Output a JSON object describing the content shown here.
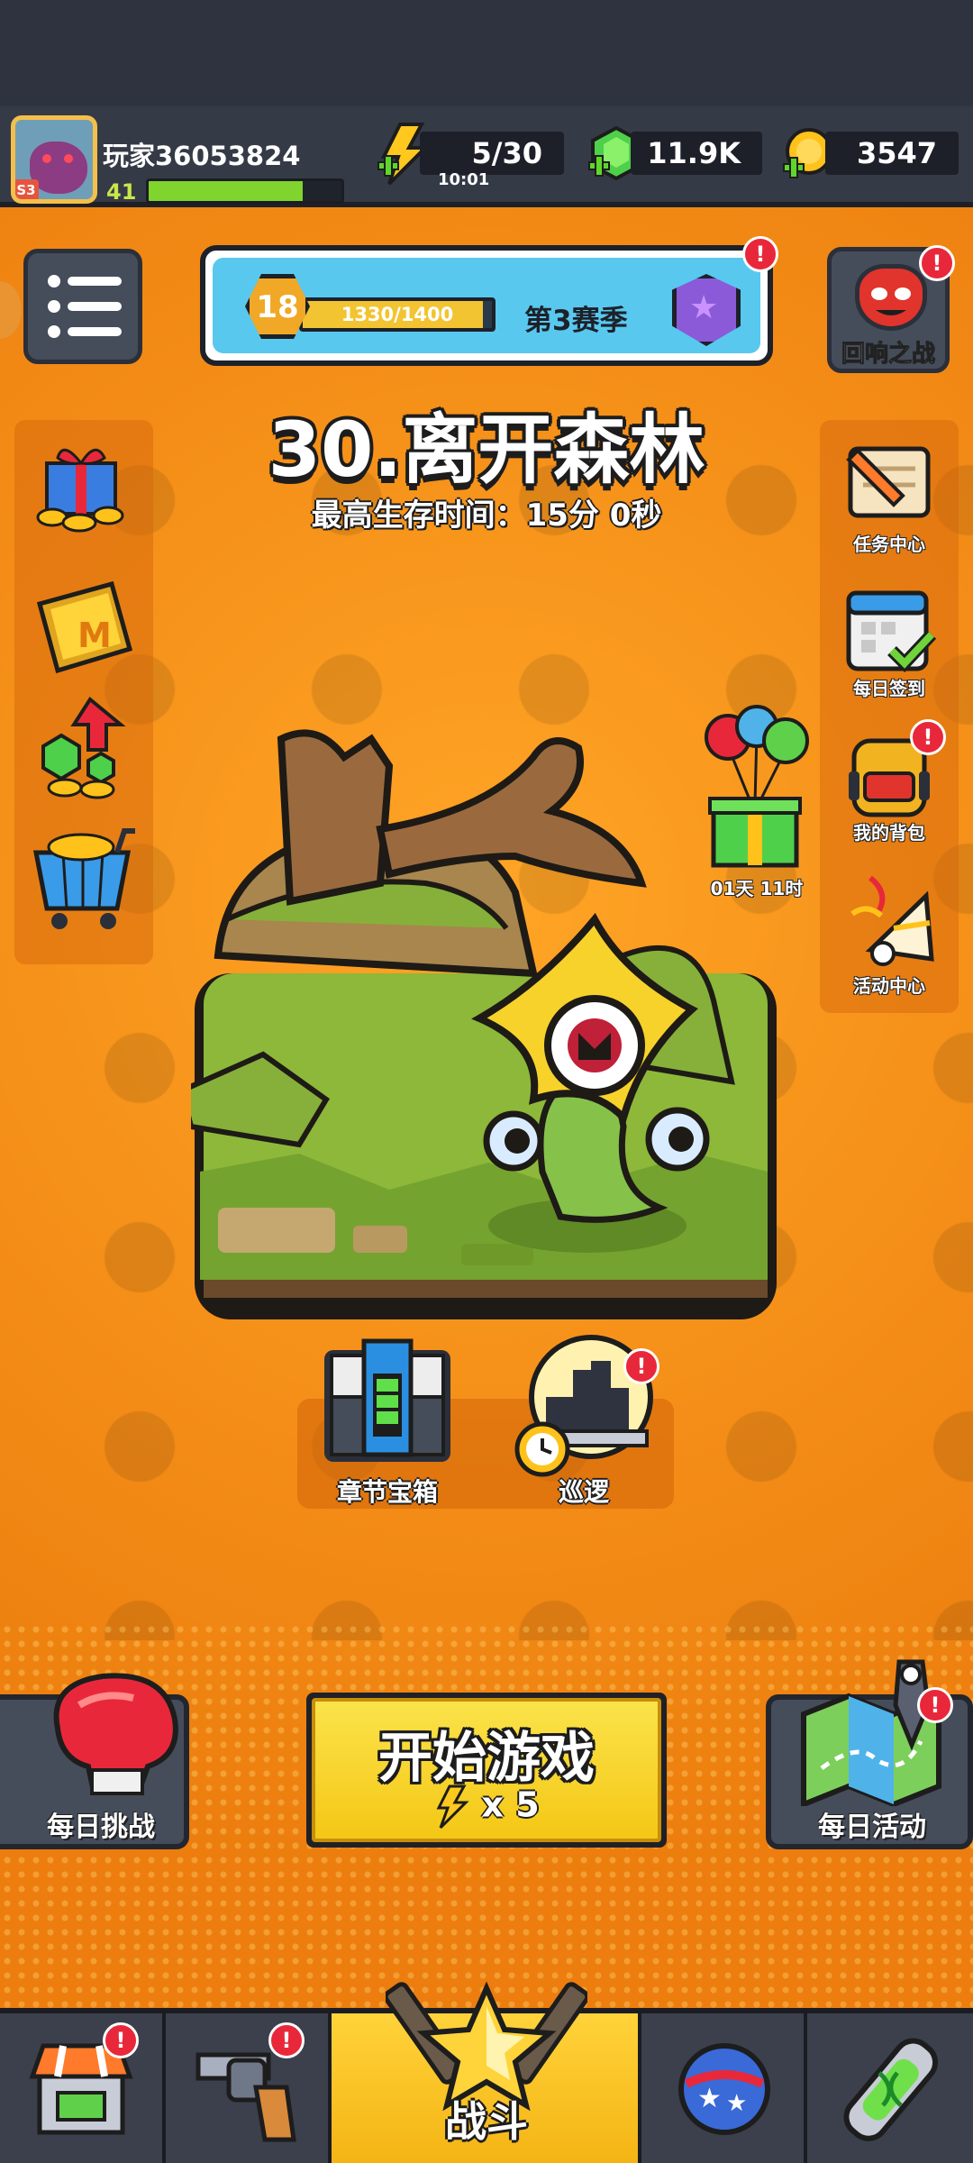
{
  "player": {
    "name": "玩家36053824",
    "level": "41",
    "badge": "S3",
    "xp_fraction": 0.8
  },
  "resources": {
    "energy": "5/30",
    "energy_timer": "10:01",
    "gems": "11.9K",
    "coins": "3547"
  },
  "season": {
    "rank": "18",
    "progress_text": "1330/1400",
    "progress_fraction": 0.95,
    "title": "第3赛季"
  },
  "echo_battle": {
    "label": "回响之战"
  },
  "stage": {
    "title": "30.离开森林",
    "best_survival": "最高生存时间：15分 0秒"
  },
  "right_menu": {
    "tasks": "任务中心",
    "checkin": "每日签到",
    "backpack": "我的背包",
    "events": "活动中心"
  },
  "gift_timer": "01天 11时",
  "chapter_chest": {
    "label": "章节宝箱"
  },
  "patrol": {
    "label": "巡逻"
  },
  "daily_challenge": {
    "label": "每日挑战"
  },
  "daily_activity": {
    "label": "每日活动"
  },
  "start_game": {
    "label": "开始游戏",
    "cost": "x 5"
  },
  "nav": {
    "battle": "战斗"
  },
  "alert_mark": "!",
  "colors": {
    "background": "#f08a12",
    "accent_yellow": "#f4c715",
    "alert_red": "#e8283a",
    "panel_dark": "#454c5a"
  },
  "icons": [
    "lightning-icon",
    "gem-icon",
    "coin-icon",
    "menu-icon",
    "gift-box-icon",
    "m-card-icon",
    "gem-upgrade-icon",
    "shopping-cart-icon",
    "scroll-quill-icon",
    "calendar-check-icon",
    "backpack-icon",
    "party-horn-icon",
    "balloon-gift-icon",
    "chest-icon",
    "patrol-clock-icon",
    "boxing-glove-icon",
    "treasure-map-icon",
    "shop-icon",
    "revolver-icon",
    "battle-star-icon",
    "orb-icon",
    "dna-capsule-icon"
  ]
}
